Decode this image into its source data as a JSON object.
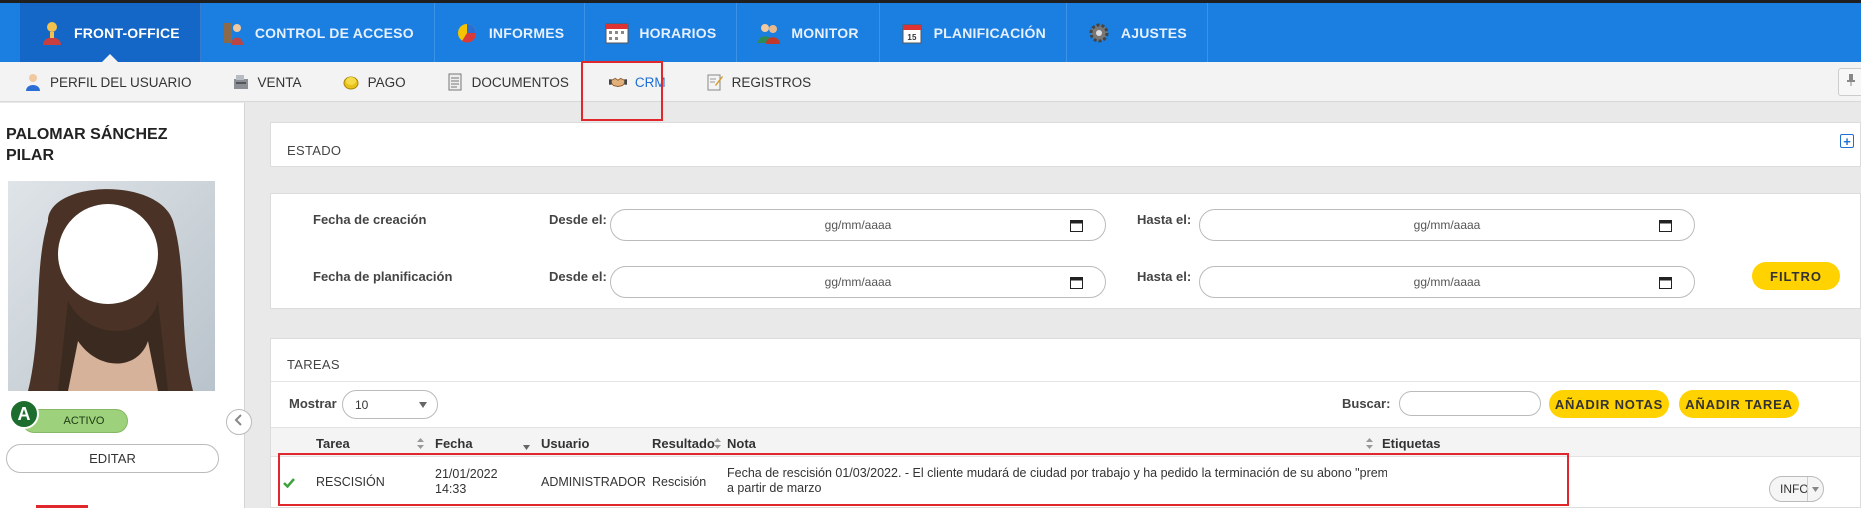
{
  "topnav": [
    {
      "label": "FRONT-OFFICE",
      "icon": "user-icon",
      "active": true
    },
    {
      "label": "CONTROL DE ACCESO",
      "icon": "access-icon"
    },
    {
      "label": "INFORMES",
      "icon": "pie-chart-icon"
    },
    {
      "label": "HORARIOS",
      "icon": "calendar-grid-icon"
    },
    {
      "label": "MONITOR",
      "icon": "people-icon"
    },
    {
      "label": "PLANIFICACIÓN",
      "icon": "calendar-icon"
    },
    {
      "label": "AJUSTES",
      "icon": "gear-icon"
    }
  ],
  "subnav": [
    {
      "label": "PERFIL DEL USUARIO",
      "icon": "user-profile-icon"
    },
    {
      "label": "VENTA",
      "icon": "register-icon"
    },
    {
      "label": "PAGO",
      "icon": "coins-icon"
    },
    {
      "label": "DOCUMENTOS",
      "icon": "document-icon"
    },
    {
      "label": "CRM",
      "icon": "handshake-icon",
      "active": true
    },
    {
      "label": "REGISTROS",
      "icon": "notepad-icon"
    }
  ],
  "client": {
    "name": "PALOMAR SÁNCHEZ PILAR",
    "badge": "A",
    "status": "ACTIVO",
    "edit_label": "EDITAR"
  },
  "estado": {
    "title": "ESTADO",
    "expand_icon": "plus-icon"
  },
  "filters": {
    "creation_label": "Fecha de creación",
    "planning_label": "Fecha de planificación",
    "from_label": "Desde el:",
    "to_label": "Hasta el:",
    "date_placeholder": "gg/mm/aaaa",
    "filter_button": "FILTRO"
  },
  "tareas": {
    "title": "TAREAS",
    "show_label": "Mostrar",
    "show_value": "10",
    "search_label": "Buscar:",
    "add_notes_button": "AÑADIR NOTAS",
    "add_task_button": "AÑADIR TAREA",
    "columns": {
      "task": "Tarea",
      "date": "Fecha",
      "user": "Usuario",
      "result": "Resultado",
      "note": "Nota",
      "tags": "Etiquetas"
    },
    "rows": [
      {
        "task": "RESCISIÓN",
        "date": "21/01/2022",
        "time": "14:33",
        "user": "ADMINISTRADOR",
        "result": "Rescisión",
        "note_line1": "Fecha de rescisión 01/03/2022. - El cliente mudará de ciudad por trabajo y ha pedido la terminación de su abono \"premium\"",
        "note_line2": "a partir de marzo",
        "action": "INFO"
      }
    ]
  },
  "colors": {
    "topbar": "#1a7fe0",
    "accent_yellow": "#ffd200",
    "highlight_red": "#e0272b",
    "status_green": "#9ed17b"
  }
}
